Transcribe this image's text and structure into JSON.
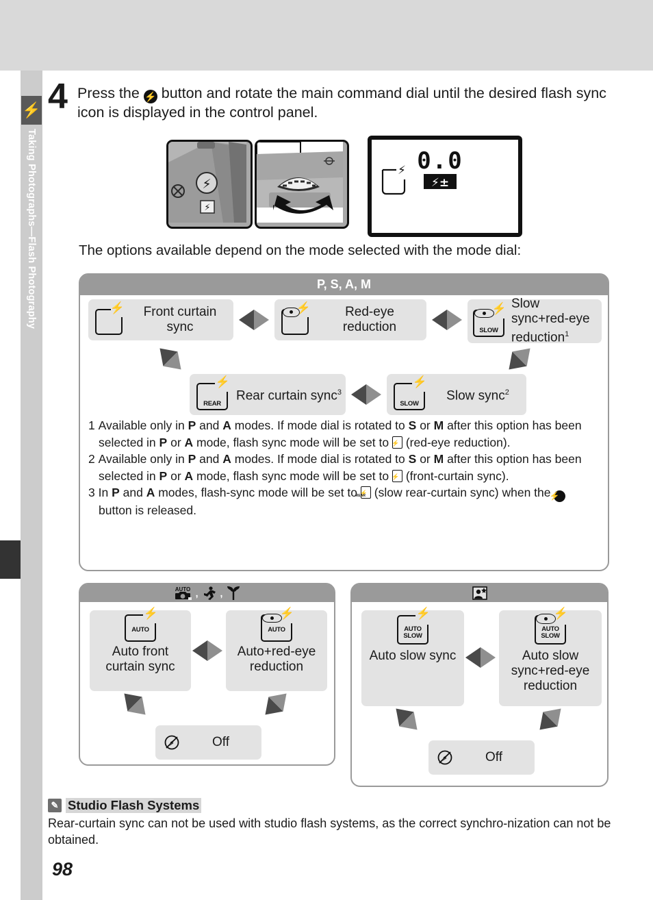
{
  "rail": {
    "tab_icon": "flash-bolt-icon",
    "chapter_label": "Taking Photographs—Flash Photography"
  },
  "step": {
    "number": "4",
    "text_before_icon": "Press the ",
    "button_icon": "flash-mode-button-icon",
    "text_after_icon": " button and rotate the main command dial until the desired flash sync icon is displayed in the control panel."
  },
  "illustration": {
    "photo1_name": "camera-flash-button-photo",
    "photo2_name": "main-command-dial-photo",
    "lcd": {
      "value": "0.0",
      "badge": "flash-compensation-icon",
      "flash_icon": "front-curtain-sync-icon"
    }
  },
  "intro": "The options available depend on the mode selected with the mode dial:",
  "psam": {
    "header": "P, S, A, M",
    "options": [
      {
        "id": "front-curtain-sync",
        "label": "Front curtain sync",
        "icon": {
          "bolt": true,
          "eye": false,
          "tag": ""
        }
      },
      {
        "id": "red-eye-reduction",
        "label": "Red-eye reduction",
        "icon": {
          "bolt": true,
          "eye": true,
          "tag": ""
        }
      },
      {
        "id": "slow-sync-red-eye-reduction",
        "label": "Slow sync+red-eye reduction",
        "sup": "1",
        "icon": {
          "bolt": true,
          "eye": true,
          "tag": "SLOW"
        }
      },
      {
        "id": "rear-curtain-sync",
        "label": "Rear curtain sync",
        "sup": "3",
        "icon": {
          "bolt": true,
          "eye": false,
          "tag": "REAR"
        }
      },
      {
        "id": "slow-sync",
        "label": "Slow sync",
        "sup": "2",
        "icon": {
          "bolt": true,
          "eye": false,
          "tag": "SLOW"
        }
      }
    ],
    "footnotes": [
      {
        "num": "1",
        "part1": "Available only in ",
        "b1": "P",
        "part2": " and ",
        "b2": "A",
        "part3": " modes.  If mode dial is rotated to ",
        "b3": "S",
        "part4": " or ",
        "b4": "M",
        "part5": " after this option has been selected in ",
        "b5": "P",
        "part6": " or ",
        "b6": "A",
        "part7": " mode, flash sync mode will be set to ",
        "icon": "red-eye-reduction-icon",
        "part8": " (red-eye reduction)."
      },
      {
        "num": "2",
        "part1": "Available only in ",
        "b1": "P",
        "part2": " and ",
        "b2": "A",
        "part3": " modes.  If mode dial is rotated to ",
        "b3": "S",
        "part4": " or ",
        "b4": "M",
        "part5": " after this option has been selected in ",
        "b5": "P",
        "part6": " or ",
        "b6": "A",
        "part7": " mode, flash sync mode will be set to ",
        "icon": "front-curtain-sync-icon",
        "part8": " (front-curtain sync)."
      },
      {
        "num": "3",
        "part1": "In ",
        "b1": "P",
        "part2": " and ",
        "b2": "A",
        "part3": " modes, flash-sync mode will be set to ",
        "icon": "slow-rear-curtain-sync-icon",
        "part4": " (slow rear-curtain sync) when the ",
        "icon2": "flash-mode-button-icon",
        "part5": " button is released."
      }
    ]
  },
  "auto_panel": {
    "mode_icons": [
      "auto-camera-icon",
      "sports-mode-icon",
      "close-up-mode-icon"
    ],
    "separator": ",",
    "options": [
      {
        "id": "auto-front-curtain-sync",
        "label": "Auto front curtain sync",
        "icon": {
          "bolt": true,
          "eye": false,
          "tag": "AUTO"
        }
      },
      {
        "id": "auto-red-eye-reduction",
        "label": "Auto+red-eye reduction",
        "icon": {
          "bolt": true,
          "eye": true,
          "tag": "AUTO"
        }
      },
      {
        "id": "flash-off",
        "label": "Off",
        "icon": {
          "off": true
        }
      }
    ]
  },
  "night_panel": {
    "mode_icons": [
      "night-portrait-mode-icon"
    ],
    "options": [
      {
        "id": "auto-slow-sync",
        "label": "Auto slow sync",
        "icon": {
          "bolt": true,
          "eye": false,
          "tag2": [
            "AUTO",
            "SLOW"
          ]
        }
      },
      {
        "id": "auto-slow-sync-red-eye-reduction",
        "label": "Auto slow sync+red-eye reduction",
        "icon": {
          "bolt": true,
          "eye": true,
          "tag2": [
            "AUTO",
            "SLOW"
          ]
        }
      },
      {
        "id": "flash-off",
        "label": "Off",
        "icon": {
          "off": true
        }
      }
    ]
  },
  "studio_note": {
    "icon": "pencil-note-icon",
    "title": "Studio Flash Systems",
    "body": "Rear-curtain sync can not be used with studio flash systems, as the correct synchro-nization can not be obtained."
  },
  "page_number": "98",
  "colors": {
    "top_band": "#d9d9d9",
    "rail": "#cccccc",
    "tab": "#595959",
    "panel_border": "#9a9a9a",
    "chip": "#e3e3e3",
    "black_tab": "#333333"
  }
}
